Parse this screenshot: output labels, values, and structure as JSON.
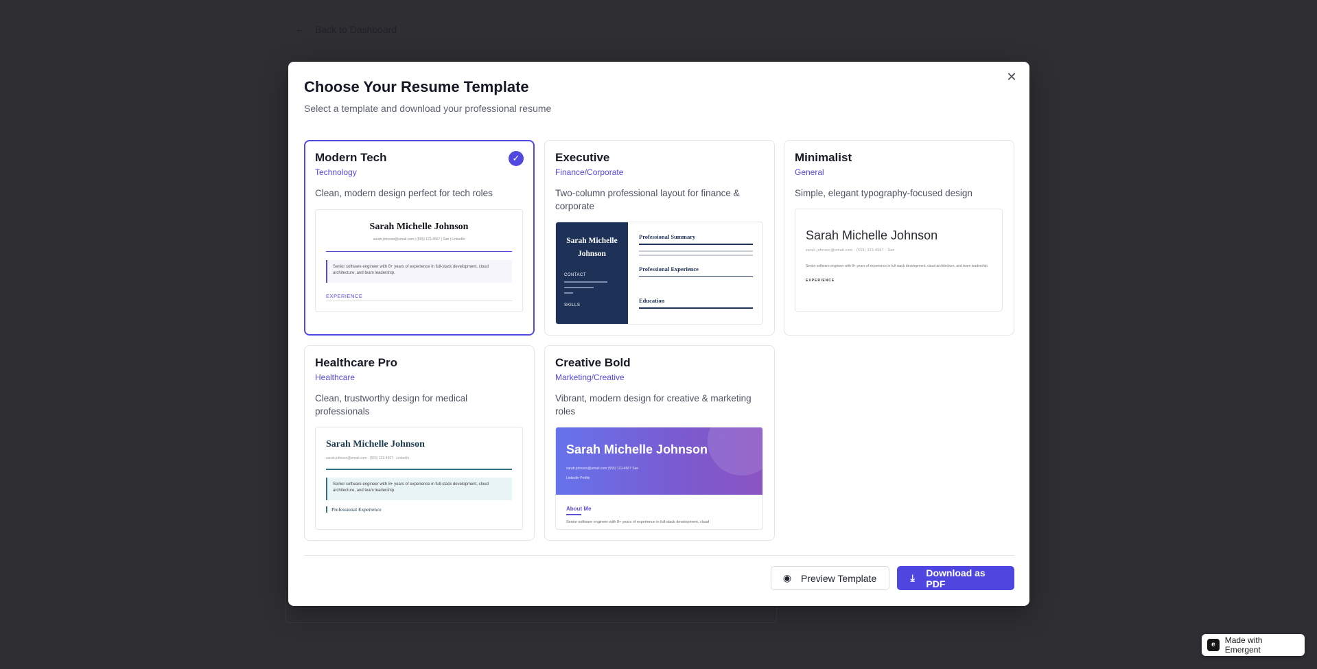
{
  "background": {
    "back_label": "Back to Dashboard"
  },
  "modal": {
    "title": "Choose Your Resume Template",
    "subtitle": "Select a template and download your professional resume",
    "accent_color": "#5148e0"
  },
  "templates": [
    {
      "name": "Modern Tech",
      "category": "Technology",
      "description": "Clean, modern design perfect for tech roles",
      "selected": true,
      "preview": {
        "name": "Sarah Michelle Johnson",
        "contact": "sarah.johnson@email.com | (555) 123-4567 | San | LinkedIn",
        "summary": "Senior software engineer with 8+ years of experience in full-stack development, cloud architecture, and team leadership.",
        "section": "EXPERIENCE"
      }
    },
    {
      "name": "Executive",
      "category": "Finance/Corporate",
      "description": "Two-column professional layout for finance & corporate",
      "selected": false,
      "preview": {
        "name": "Sarah Michelle Johnson",
        "contact_label": "CONTACT",
        "skills_label": "SKILLS",
        "section1": "Professional Summary",
        "section2": "Professional Experience",
        "section3": "Education"
      }
    },
    {
      "name": "Minimalist",
      "category": "General",
      "description": "Simple, elegant typography-focused design",
      "selected": false,
      "preview": {
        "name": "Sarah Michelle Johnson",
        "contact": "sarah.johnson@email.com · (555) 123-4567 · San",
        "summary": "Senior software engineer with 8+ years of experience in full-stack development, cloud architecture, and team leadership.",
        "section": "EXPERIENCE"
      }
    },
    {
      "name": "Healthcare Pro",
      "category": "Healthcare",
      "description": "Clean, trustworthy design for medical professionals",
      "selected": false,
      "preview": {
        "name": "Sarah Michelle Johnson",
        "contact": "sarah.johnson@email.com · (555) 123-4567 · LinkedIn",
        "summary": "Senior software engineer with 8+ years of experience in full-stack development, cloud architecture, and team leadership.",
        "section": "Professional Experience"
      }
    },
    {
      "name": "Creative Bold",
      "category": "Marketing/Creative",
      "description": "Vibrant, modern design for creative & marketing roles",
      "selected": false,
      "preview": {
        "name": "Sarah Michelle Johnson",
        "contact": "sarah.johnson@email.com    (555) 123-4567    San",
        "contact2": "LinkedIn Profile",
        "section": "About Me",
        "summary": "Senior software engineer with 8+ years of experience in full-stack development, cloud"
      }
    }
  ],
  "footer": {
    "preview_label": "Preview Template",
    "download_label": "Download as PDF"
  },
  "badge": {
    "label": "Made with Emergent",
    "logo": "e"
  },
  "icons": {
    "back": "arrow-left-icon",
    "close": "close-icon",
    "check": "check-icon",
    "preview": "eye-icon",
    "download": "download-icon"
  }
}
